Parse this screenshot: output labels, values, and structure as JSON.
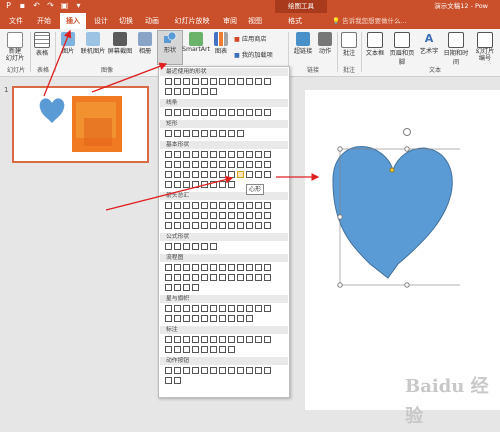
{
  "titlebar": {
    "context_group": "绘图工具",
    "doc_title": "演示文稿12 - Pow"
  },
  "tabs": [
    "文件",
    "开始",
    "插入",
    "设计",
    "切换",
    "动画",
    "幻灯片放映",
    "审阅",
    "视图",
    "格式"
  ],
  "tell_me": "告诉我您想要做什么...",
  "ribbon": {
    "new_slide": "新建\n幻灯片",
    "table": "表格",
    "picture": "图片",
    "online_picture": "联机图片",
    "screenshot": "屏幕截图",
    "album": "相册",
    "shapes": "形状",
    "smartart": "SmartArt",
    "chart": "图表",
    "store": "应用商店",
    "my_addins": "我的加载项",
    "hyperlink": "超链接",
    "action": "动作",
    "comment": "批注",
    "textbox": "文本框",
    "header_footer": "页眉和页脚",
    "wordart": "艺术字",
    "datetime": "日期和时间",
    "slide_number": "幻灯片\n编号",
    "groups": {
      "slides": "幻灯片",
      "tables": "表格",
      "images": "图像",
      "links": "链接",
      "comments": "批注",
      "text": "文本"
    }
  },
  "thumb_number": "1",
  "gallery": {
    "sections": [
      "最近使用的形状",
      "线条",
      "矩形",
      "基本形状",
      "箭头总汇",
      "公式形状",
      "流程图",
      "星与旗帜",
      "标注",
      "动作按钮"
    ],
    "tooltip": "心形"
  },
  "watermark": "Baidu 经验",
  "colors": {
    "brand": "#c9502b",
    "heart": "#5b9bd5",
    "arrow": "#e02020"
  }
}
